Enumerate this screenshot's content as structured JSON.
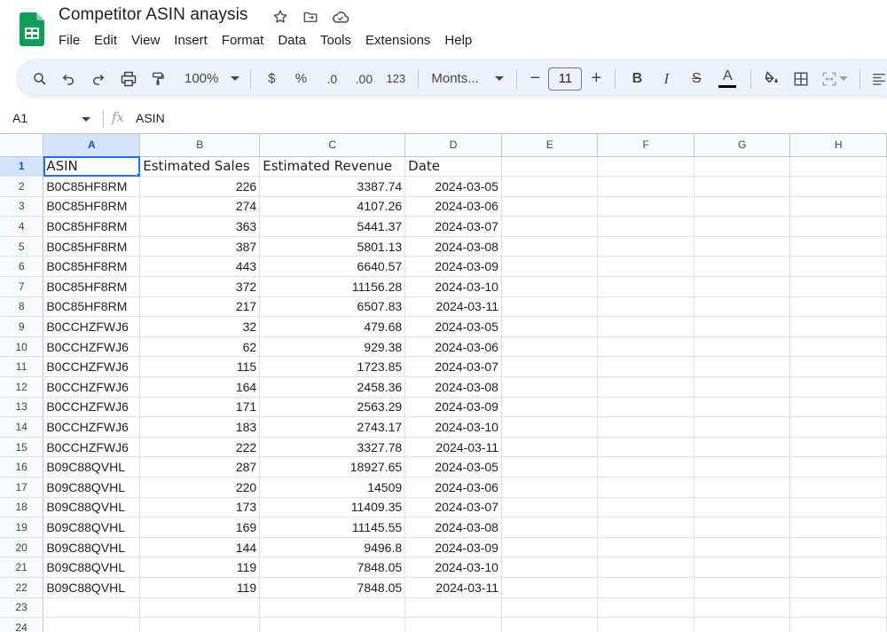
{
  "app": {
    "title": "Competitor ASIN anaysis",
    "menu": [
      "File",
      "Edit",
      "View",
      "Insert",
      "Format",
      "Data",
      "Tools",
      "Extensions",
      "Help"
    ]
  },
  "toolbar": {
    "zoom": "100%",
    "currency": "$",
    "percent": "%",
    "decrease_decimal": ".0",
    "increase_decimal": ".00",
    "number_format": "123",
    "font": "Monts...",
    "font_size": "11",
    "minus": "−",
    "plus": "+",
    "bold": "B",
    "italic": "I",
    "strike": "S",
    "text_color_letter": "A"
  },
  "formula_bar": {
    "cell_ref": "A1",
    "fx": "fx",
    "content": "ASIN"
  },
  "columns": [
    "A",
    "B",
    "C",
    "D",
    "E",
    "F",
    "G",
    "H"
  ],
  "header_row": [
    "ASIN",
    "Estimated Sales",
    "Estimated Revenue",
    "Date"
  ],
  "rows": [
    [
      "B0C85HF8RM",
      "226",
      "3387.74",
      "2024-03-05"
    ],
    [
      "B0C85HF8RM",
      "274",
      "4107.26",
      "2024-03-06"
    ],
    [
      "B0C85HF8RM",
      "363",
      "5441.37",
      "2024-03-07"
    ],
    [
      "B0C85HF8RM",
      "387",
      "5801.13",
      "2024-03-08"
    ],
    [
      "B0C85HF8RM",
      "443",
      "6640.57",
      "2024-03-09"
    ],
    [
      "B0C85HF8RM",
      "372",
      "11156.28",
      "2024-03-10"
    ],
    [
      "B0C85HF8RM",
      "217",
      "6507.83",
      "2024-03-11"
    ],
    [
      "B0CCHZFWJ6",
      "32",
      "479.68",
      "2024-03-05"
    ],
    [
      "B0CCHZFWJ6",
      "62",
      "929.38",
      "2024-03-06"
    ],
    [
      "B0CCHZFWJ6",
      "115",
      "1723.85",
      "2024-03-07"
    ],
    [
      "B0CCHZFWJ6",
      "164",
      "2458.36",
      "2024-03-08"
    ],
    [
      "B0CCHZFWJ6",
      "171",
      "2563.29",
      "2024-03-09"
    ],
    [
      "B0CCHZFWJ6",
      "183",
      "2743.17",
      "2024-03-10"
    ],
    [
      "B0CCHZFWJ6",
      "222",
      "3327.78",
      "2024-03-11"
    ],
    [
      "B09C88QVHL",
      "287",
      "18927.65",
      "2024-03-05"
    ],
    [
      "B09C88QVHL",
      "220",
      "14509",
      "2024-03-06"
    ],
    [
      "B09C88QVHL",
      "173",
      "11409.35",
      "2024-03-07"
    ],
    [
      "B09C88QVHL",
      "169",
      "11145.55",
      "2024-03-08"
    ],
    [
      "B09C88QVHL",
      "144",
      "9496.8",
      "2024-03-09"
    ],
    [
      "B09C88QVHL",
      "119",
      "7848.05",
      "2024-03-10"
    ],
    [
      "B09C88QVHL",
      "119",
      "7848.05",
      "2024-03-11"
    ]
  ],
  "row_numbers": [
    "1",
    "2",
    "3",
    "4",
    "5",
    "6",
    "7",
    "8",
    "9",
    "10",
    "11",
    "12",
    "13",
    "14",
    "15",
    "16",
    "17",
    "18",
    "19",
    "20",
    "21",
    "22",
    "23",
    "24"
  ],
  "colors": {
    "accent": "#1a73e8",
    "selected_header": "#d3e3fd",
    "toolbar_bg": "#edf2fa",
    "sheets_green": "#0f9d58"
  }
}
